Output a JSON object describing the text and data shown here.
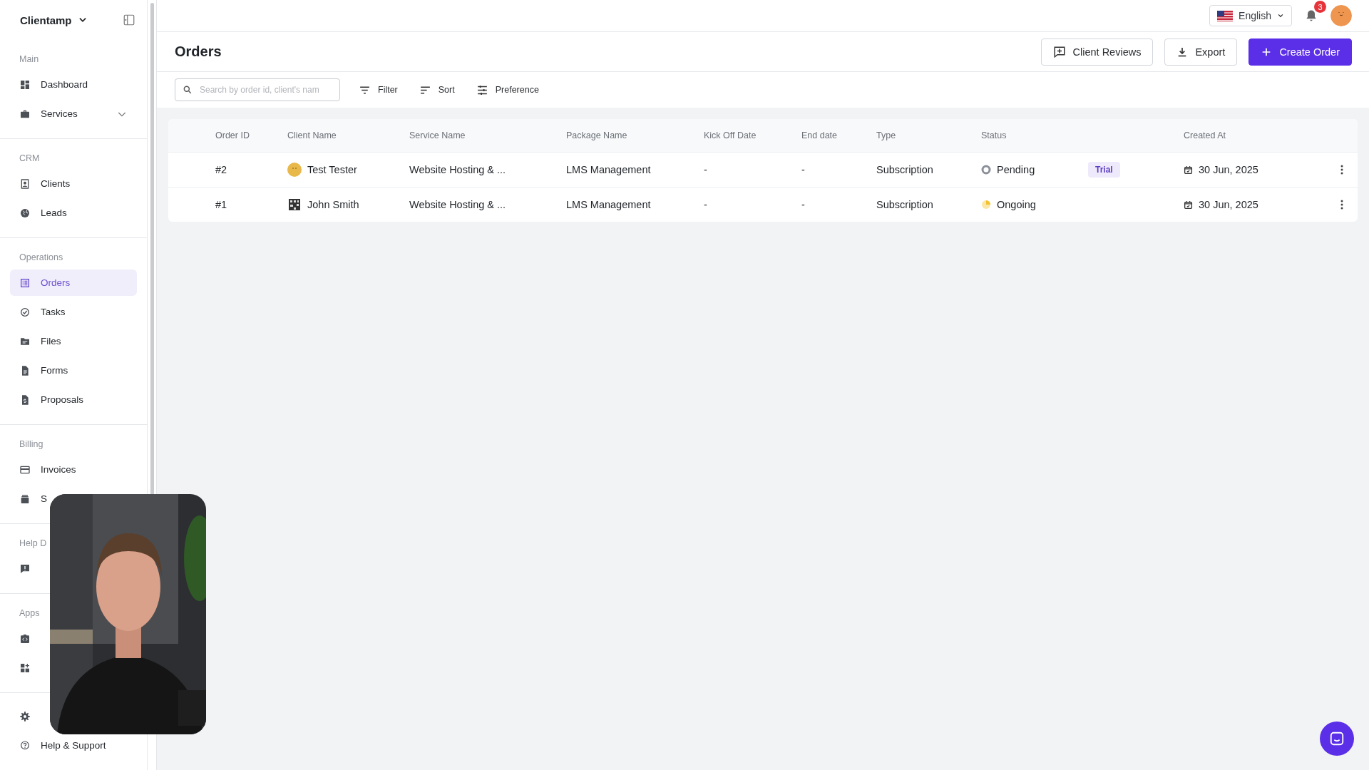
{
  "sidebar": {
    "workspace": "Clientamp",
    "sections": [
      {
        "label": "Main",
        "items": [
          {
            "label": "Dashboard",
            "selected": false
          },
          {
            "label": "Services",
            "selected": false,
            "expandable": true
          }
        ]
      },
      {
        "label": "CRM",
        "items": [
          {
            "label": "Clients",
            "selected": false
          },
          {
            "label": "Leads",
            "selected": false
          }
        ]
      },
      {
        "label": "Operations",
        "items": [
          {
            "label": "Orders",
            "selected": true
          },
          {
            "label": "Tasks",
            "selected": false
          },
          {
            "label": "Files",
            "selected": false
          },
          {
            "label": "Forms",
            "selected": false
          },
          {
            "label": "Proposals",
            "selected": false
          }
        ]
      },
      {
        "label": "Billing",
        "items": [
          {
            "label": "Invoices",
            "selected": false
          },
          {
            "label": "S",
            "selected": false
          }
        ]
      },
      {
        "label": "Help D",
        "items": [
          {
            "selected": false
          }
        ]
      },
      {
        "label": "Apps",
        "items": [
          {
            "selected": false
          },
          {
            "selected": false
          }
        ]
      },
      {
        "items": [
          {
            "selected": false
          },
          {
            "label": "Help & Support",
            "selected": false
          }
        ]
      }
    ]
  },
  "top_bar": {
    "language": "English",
    "notifications": "3"
  },
  "page": {
    "title": "Orders",
    "buttons": [
      {
        "label": "Client Reviews",
        "kind": "outline"
      },
      {
        "label": "Export",
        "kind": "outline"
      },
      {
        "label": "Create Order",
        "kind": "primary"
      }
    ]
  },
  "toolbar": {
    "search": {
      "placeholder": "Search by order id, client's nam"
    },
    "actions": [
      "Filter",
      "Sort",
      "Preference"
    ]
  },
  "table": {
    "columns": [
      "Order ID",
      "Client Name",
      "Service Name",
      "Package Name",
      "Kick Off Date",
      "End date",
      "Type",
      "Status",
      "Created At"
    ],
    "rows": [
      {
        "order_id": "#2",
        "client": "Test Tester",
        "service": "Website Hosting & ...",
        "package": "LMS Management",
        "kick_off": "-",
        "end": "-",
        "type": "Subscription",
        "status": {
          "label": "Pending",
          "kind": "pending"
        },
        "tag": "Trial",
        "created": "30 Jun, 2025"
      },
      {
        "order_id": "#1",
        "client": "John Smith",
        "service": "Website Hosting & ...",
        "package": "LMS Management",
        "kick_off": "-",
        "end": "-",
        "type": "Subscription",
        "status": {
          "label": "Ongoing",
          "kind": "ongoing"
        },
        "created": "30 Jun, 2025"
      }
    ]
  }
}
